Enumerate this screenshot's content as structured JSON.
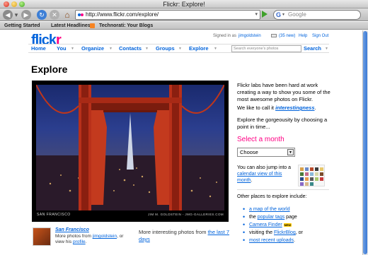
{
  "window": {
    "title": "Flickr: Explore!"
  },
  "toolbar": {
    "url": "http://www.flickr.com/explore/",
    "search_placeholder": "Google",
    "search_engine_glyph": "G"
  },
  "bookmarks": [
    "Getting Started",
    "Latest Headlines",
    "Technorati: Your Blogs"
  ],
  "header": {
    "logo_main": "flick",
    "logo_accent": "r",
    "signed_in_as": "Signed in as",
    "username": "jimgoldstein",
    "new_count": "(35 new)",
    "help": "Help",
    "sign_out": "Sign Out",
    "nav": [
      "Home",
      "You",
      "Organize",
      "Contacts",
      "Groups",
      "Explore"
    ],
    "search_placeholder": "Search everyone's photos",
    "search_label": "Search"
  },
  "page_title": "Explore",
  "photo": {
    "caption_left": "SAN FRANCISCO",
    "caption_right": "JIM M. GOLDSTEIN - JMG-GALLERIES.COM",
    "title": "San Francisco",
    "meta_prefix": "More photos from",
    "meta_user": "jimgoldstein",
    "meta_mid": ", or view his",
    "meta_profile": "profile",
    "meta_suffix": "."
  },
  "more_interesting": {
    "text": "More interesting photos from",
    "link": "the last 7 days"
  },
  "sidebar": {
    "intro": "Flickr labs have been hard at work creating a way to show you some of the most awesome photos on Flickr.",
    "call_prefix": "We like to call it",
    "call_link": "interestingness",
    "call_suffix": ".",
    "explore_text": "Explore the gorgeousity by choosing a point in time...",
    "select_month": "Select a month",
    "month_selected": "Choose",
    "jump_prefix": "You can also jump into a",
    "jump_link": "calendar view of this month",
    "jump_suffix": ".",
    "other_places": "Other places to explore include:",
    "places": [
      {
        "prefix": "",
        "link": "a map of the world",
        "suffix": ""
      },
      {
        "prefix": "the",
        "link": "popular tags",
        "suffix": "page"
      },
      {
        "prefix": "",
        "link": "Camera Finder",
        "suffix": "",
        "badge": "NEW"
      },
      {
        "prefix": "visiting the",
        "link": "FlickrBlog",
        "suffix": ", or"
      },
      {
        "prefix": "",
        "link": "most recent uploads",
        "suffix": "."
      }
    ]
  },
  "colors": {
    "flickr_blue": "#0063dc",
    "flickr_pink": "#ff0084",
    "bridge_red": "#c0361a"
  }
}
